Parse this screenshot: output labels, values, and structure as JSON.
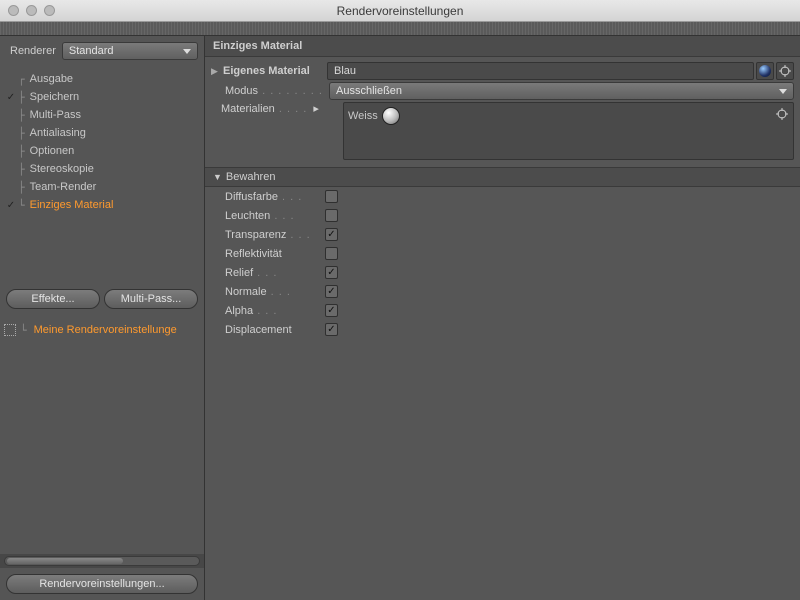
{
  "window": {
    "title": "Rendervoreinstellungen"
  },
  "sidebar": {
    "renderer_label": "Renderer",
    "renderer_value": "Standard",
    "items": [
      {
        "label": "Ausgabe",
        "checked": ""
      },
      {
        "label": "Speichern",
        "checked": "✓"
      },
      {
        "label": "Multi-Pass",
        "checked": ""
      },
      {
        "label": "Antialiasing",
        "checked": ""
      },
      {
        "label": "Optionen",
        "checked": ""
      },
      {
        "label": "Stereoskopie",
        "checked": ""
      },
      {
        "label": "Team-Render",
        "checked": ""
      },
      {
        "label": "Einziges Material",
        "checked": "✓"
      }
    ],
    "effects_btn": "Effekte...",
    "multipass_btn": "Multi-Pass...",
    "preset_label": "Meine Rendervoreinstellunge",
    "footer_btn": "Rendervoreinstellungen..."
  },
  "panel": {
    "title": "Einziges Material",
    "own_material_label": "Eigenes Material",
    "own_material_value": "Blau",
    "mode_label": "Modus",
    "mode_value": "Ausschließen",
    "materials_label": "Materialien",
    "materials_item": "Weiss",
    "section_preserve": "Bewahren",
    "checks": [
      {
        "label": "Diffusfarbe",
        "on": false
      },
      {
        "label": "Leuchten",
        "on": false
      },
      {
        "label": "Transparenz",
        "on": true
      },
      {
        "label": "Reflektivität",
        "on": false
      },
      {
        "label": "Relief",
        "on": true
      },
      {
        "label": "Normale",
        "on": true
      },
      {
        "label": "Alpha",
        "on": true
      },
      {
        "label": "Displacement",
        "on": true
      }
    ]
  }
}
